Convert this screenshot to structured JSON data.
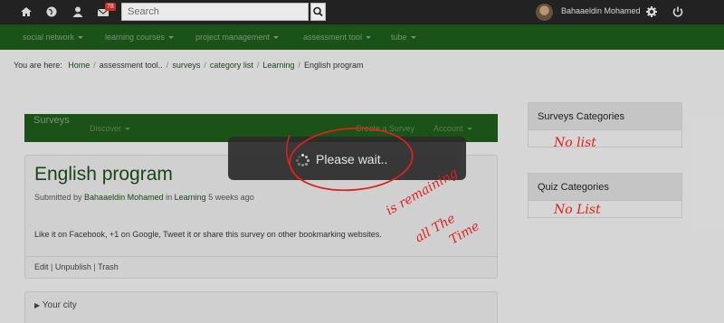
{
  "topbar": {
    "notification_count": "78",
    "search_placeholder": "Search",
    "user_name": "Bahaaeldin Mohamed"
  },
  "nav": {
    "items": [
      {
        "label": "social network"
      },
      {
        "label": "learning courses"
      },
      {
        "label": "project management"
      },
      {
        "label": "assessment tool"
      },
      {
        "label": "tube"
      }
    ]
  },
  "breadcrumb": {
    "prefix": "You are here:",
    "items": [
      "Home",
      "assessment tool..",
      "surveys",
      "category list",
      "Learning",
      "English program"
    ]
  },
  "surveys": {
    "title": "Surveys",
    "discover": "Discover",
    "create": "Create a Survey",
    "account": "Account"
  },
  "card": {
    "title": "English program",
    "submitted_by": "Submitted by",
    "author": "Bahaaeldin Mohamed",
    "in": "in",
    "category": "Learning",
    "time_ago": "5 weeks ago",
    "share_text": "Like it on Facebook, +1 on Google, Tweet it or share this survey on other bookmarking websites.",
    "actions": [
      "Edit",
      "Unpublish",
      "Trash"
    ]
  },
  "city": {
    "label": "Your city"
  },
  "sidebar": {
    "surveys_categories": "Surveys Categories",
    "quiz_categories": "Quiz Categories"
  },
  "loader": {
    "text": "Please wait.."
  },
  "annotations": {
    "note_survey_list": "No list",
    "note_quiz_list": "No List",
    "note_line1": "is remaining",
    "note_line2": "all The",
    "note_line3": "Time"
  },
  "colors": {
    "topbar": "#252525",
    "nav_green": "#1d5a1b",
    "annotation_red": "#e0201c"
  }
}
